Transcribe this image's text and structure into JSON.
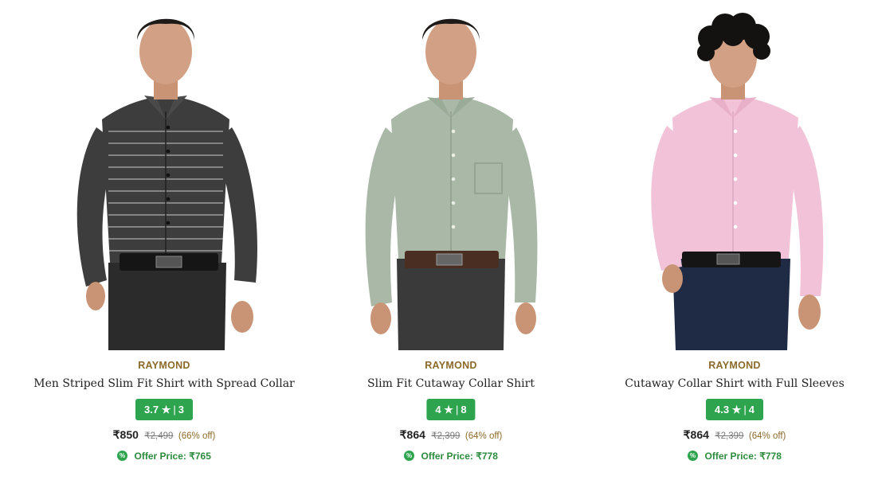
{
  "products": [
    {
      "brand": "RAYMOND",
      "title": "Men Striped Slim Fit Shirt with Spread Collar",
      "rating": "3.7",
      "rating_count": "3",
      "price": "₹850",
      "mrp": "₹2,499",
      "discount": "(66% off)",
      "offer_price": "Offer Price: ₹765",
      "image_alt": "model wearing black and white striped shirt",
      "shirt_color": "#3d3d3d",
      "pants_color": "#2b2b2b",
      "hair_style": "short"
    },
    {
      "brand": "RAYMOND",
      "title": "Slim Fit Cutaway Collar Shirt",
      "rating": "4",
      "rating_count": "8",
      "price": "₹864",
      "mrp": "₹2,399",
      "discount": "(64% off)",
      "offer_price": "Offer Price: ₹778",
      "image_alt": "model wearing sage green shirt",
      "shirt_color": "#a9b8a7",
      "pants_color": "#3a3a3a",
      "hair_style": "short"
    },
    {
      "brand": "RAYMOND",
      "title": "Cutaway Collar Shirt with Full Sleeves",
      "rating": "4.3",
      "rating_count": "4",
      "price": "₹864",
      "mrp": "₹2,399",
      "discount": "(64% off)",
      "offer_price": "Offer Price: ₹778",
      "image_alt": "model wearing light pink shirt",
      "shirt_color": "#f2c3d8",
      "pants_color": "#1f2a44",
      "hair_style": "curly"
    }
  ],
  "icons": {
    "star": "star-icon",
    "offer": "offer-percent-icon"
  },
  "colors": {
    "brand_text": "#8b6a2b",
    "rating_badge": "#2ea44f",
    "offer_text": "#2e8b3e"
  }
}
